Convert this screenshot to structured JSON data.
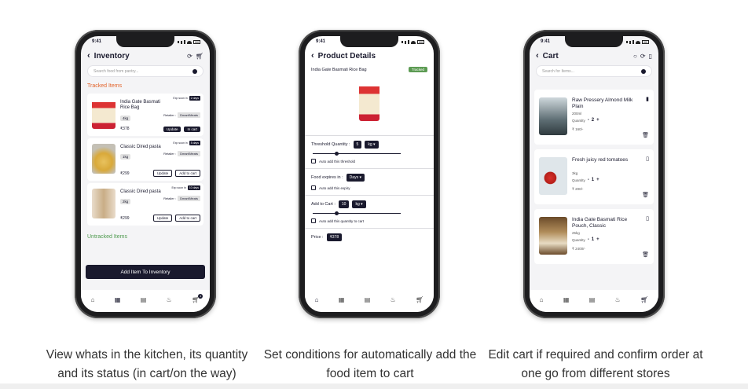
{
  "phone1": {
    "time": "9:41",
    "title": "Inventory",
    "search_placeholder": "Search food from pantry...",
    "tracked_label": "Tracked  Items",
    "untracked_label": "Untracked  Items",
    "items": [
      {
        "name": "India Gate Basmati Rice Bag",
        "qty": "4kg",
        "price": "₹378",
        "exp_label": "Exp soon in",
        "exp_val": "2 days",
        "retailer_label": "Retailer :",
        "retailer_val": "Dmart/Meats",
        "btn1": "Update",
        "btn2": "In cart"
      },
      {
        "name": "Classic Dired pasta",
        "qty": "1kg",
        "price": "₹299",
        "exp_label": "Exp soon in",
        "exp_val": "5 days",
        "retailer_label": "Retailer :",
        "retailer_val": "Dmart/Meats",
        "btn1": "Update",
        "btn2": "Add to cart"
      },
      {
        "name": "Classic Dired pasta",
        "qty": "2kg",
        "price": "₹299",
        "exp_label": "Exp soon in",
        "exp_val": "10 days",
        "retailer_label": "Retailer :",
        "retailer_val": "Dmart/Meats",
        "btn1": "Update",
        "btn2": "Add to cart"
      }
    ],
    "add_button": "Add Item To Inventory",
    "cart_badge": "1"
  },
  "phone2": {
    "time": "9:41",
    "title": "Product Details",
    "product_name": "India Gate Basmati Rice Bag",
    "tag": "Tracked",
    "threshold_label": "Threshold Quantity :",
    "threshold_value": "5",
    "threshold_unit": "kg",
    "threshold_slider": 0.25,
    "auto_threshold": "Auto add this threshold",
    "expires_label": "Food expires in :",
    "expires_unit": "Days",
    "auto_expiry": "Auto add this expiry",
    "add_cart_label": "Add to Cart :",
    "add_cart_value": "10",
    "add_cart_unit": "kg",
    "add_cart_slider": 0.25,
    "auto_qty": "Auto add this quantity to cart",
    "price_label": "Price :",
    "price_value": "₹378"
  },
  "phone3": {
    "time": "9:41",
    "title": "Cart",
    "search_placeholder": "Search for Items...",
    "items": [
      {
        "name": "Raw Pressery Almond Milk Plain",
        "size": "200ml",
        "qty_label": "Quantity",
        "qty": "2",
        "price": "₹ 160/-"
      },
      {
        "name": "Fresh juicy red tomatoes",
        "size": "3kg",
        "qty_label": "Quantity",
        "qty": "1",
        "price": "₹ 200/-"
      },
      {
        "name": "India Gate Basmati Rice Pouch, Classic",
        "size": "25kg",
        "qty_label": "Quantity",
        "qty": "1",
        "price": "₹ 2400/-"
      }
    ]
  },
  "captions": {
    "c1": "View whats in the kitchen, its quantity and its status (in cart/on the way)",
    "c2": "Set conditions for automatically add the food item to cart",
    "c3": "Edit cart if required and confirm order at one go from different stores"
  },
  "icons": {
    "home": "home-icon",
    "grid": "grid-icon",
    "list": "list-icon",
    "chef": "chef-icon",
    "cart": "cart-icon"
  }
}
